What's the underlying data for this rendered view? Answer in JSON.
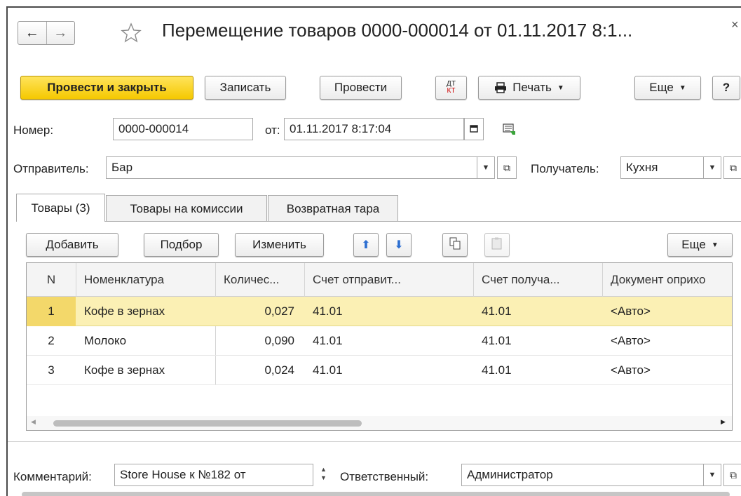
{
  "header": {
    "title": "Перемещение товаров 0000-000014 от 01.11.2017 8:1...",
    "back_icon": "←",
    "forward_icon": "→",
    "close_icon": "×"
  },
  "toolbar": {
    "post_close": "Провести и закрыть",
    "save": "Записать",
    "post": "Провести",
    "dtkt_top": "ДТ",
    "dtkt_bottom": "КТ",
    "print": "Печать",
    "more": "Еще",
    "help": "?"
  },
  "form": {
    "number_label": "Номер:",
    "number_value": "0000-000014",
    "date_label": "от:",
    "date_value": "01.11.2017  8:17:04",
    "sender_label": "Отправитель:",
    "sender_value": "Бар",
    "receiver_label": "Получатель:",
    "receiver_value": "Кухня",
    "comment_label": "Комментарий:",
    "comment_value": "Store House к №182 от",
    "responsible_label": "Ответственный:",
    "responsible_value": "Администратор"
  },
  "tabs": [
    {
      "label": "Товары (3)"
    },
    {
      "label": "Товары на комиссии"
    },
    {
      "label": "Возвратная тара"
    }
  ],
  "table_toolbar": {
    "add": "Добавить",
    "pick": "Подбор",
    "edit": "Изменить",
    "more": "Еще"
  },
  "table": {
    "columns": [
      "N",
      "Номенклатура",
      "Количес...",
      "Счет отправит...",
      "Счет получа...",
      "Документ оприхо"
    ],
    "rows": [
      {
        "n": "1",
        "item": "Кофе в зернах",
        "qty": "0,027",
        "acc_from": "41.01",
        "acc_to": "41.01",
        "doc": "<Авто>",
        "selected": true
      },
      {
        "n": "2",
        "item": "Молоко",
        "qty": "0,090",
        "acc_from": "41.01",
        "acc_to": "41.01",
        "doc": "<Авто>",
        "selected": false
      },
      {
        "n": "3",
        "item": "Кофе в зернах",
        "qty": "0,024",
        "acc_from": "41.01",
        "acc_to": "41.01",
        "doc": "<Авто>",
        "selected": false
      }
    ]
  },
  "colors": {
    "accent_yellow": "#f5c800",
    "selected_row": "#fbf0b4",
    "selected_cell": "#f3d86a",
    "arrow_blue": "#2d6fd1"
  }
}
